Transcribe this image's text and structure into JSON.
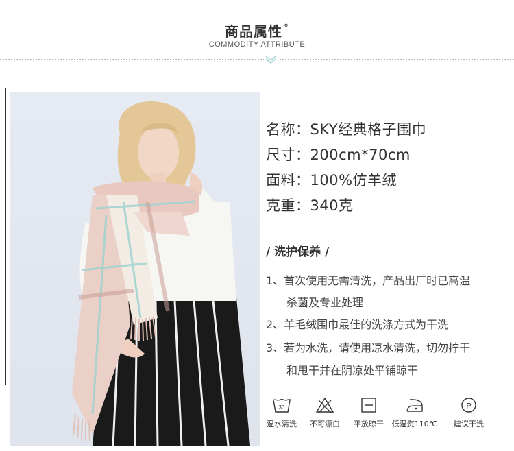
{
  "header": {
    "title": "商品属性",
    "degree": "°",
    "subtitle": "COMMODITY ATTRIBUTE"
  },
  "attributes": [
    {
      "label": "名称：",
      "value": "SKY经典格子围巾"
    },
    {
      "label": "尺寸：",
      "value": "200cm*70cm"
    },
    {
      "label": "面料：",
      "value": "100%仿羊绒"
    },
    {
      "label": "克重：",
      "value": "340克"
    }
  ],
  "care": {
    "title": "/ 洗护保养 /",
    "lines": [
      "1、首次使用无需清洗，产品出厂时已高温",
      "杀菌及专业处理",
      "2、羊毛绒围巾最佳的洗涤方式为干洗",
      "3、若为水洗，请使用凉水清洗，切勿拧干",
      "和甩干并在阴凉处平铺晾干"
    ]
  },
  "care_icons": [
    {
      "icon": "wash-30-icon",
      "label": "温水清洗",
      "text": "30"
    },
    {
      "icon": "no-bleach-icon",
      "label": "不可漂白"
    },
    {
      "icon": "dry-flat-icon",
      "label": "平放晾干"
    },
    {
      "icon": "low-iron-icon",
      "label": "低温熨110℃"
    },
    {
      "icon": "dry-clean-icon",
      "label": "建议干洗",
      "text": "P"
    }
  ],
  "colors": {
    "text": "#333333",
    "scarf_pink": "#e9c8bf",
    "scarf_cream": "#f3ece4",
    "scarf_teal": "#9fd3d0",
    "background_photo": "#e2e7ef"
  }
}
